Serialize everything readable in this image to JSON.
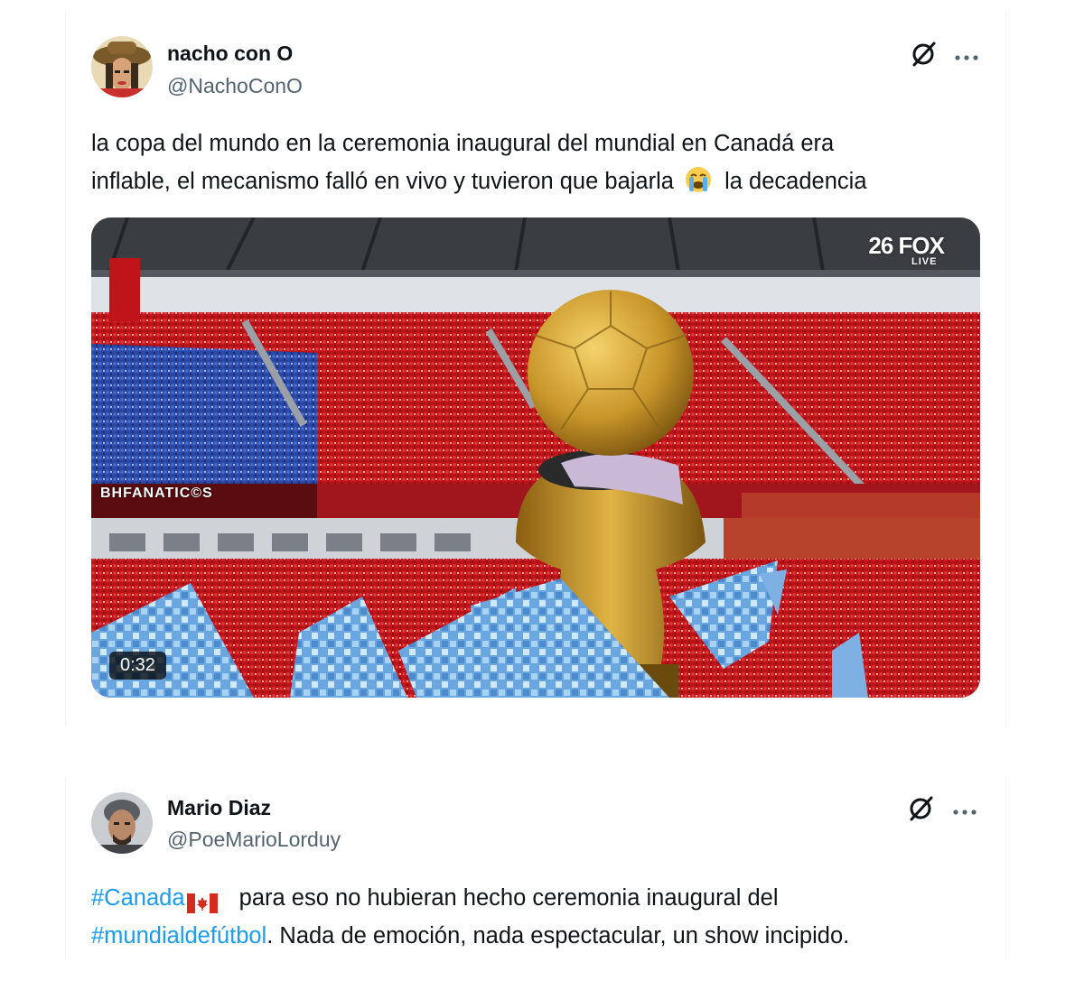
{
  "posts": [
    {
      "author_name": "nacho con O",
      "author_handle": "@NachoConO",
      "text_line1": "la copa del mundo en la ceremonia inaugural del mundial en Canadá era",
      "text_line2a": "inflable, el mecanismo falló en vivo y tuvieron que bajarla",
      "text_line2b": "la decadencia",
      "emoji": "loudly-crying-face",
      "video": {
        "duration": "0:32",
        "broadcaster": "26 FOX",
        "live_label": "LIVE",
        "board_text": "BHFANATIC©S"
      }
    },
    {
      "author_name": "Mario Diaz",
      "author_handle": "@PoeMarioLorduy",
      "hashtag1": "#Canada",
      "emoji": "canada-flag",
      "text_part1": "  para eso no hubieran hecho ceremonia inaugural del",
      "hashtag2": "#mundialdefútbol",
      "text_part2": ". Nada de emoción, nada espectacular, un show incipido."
    }
  ],
  "icons": {
    "grok": "grok-icon",
    "more": "more-icon"
  },
  "colors": {
    "hashtag": "#1d9bf0",
    "text": "#0f1419",
    "secondary": "#536471",
    "crowd_red": "#c0141b"
  }
}
